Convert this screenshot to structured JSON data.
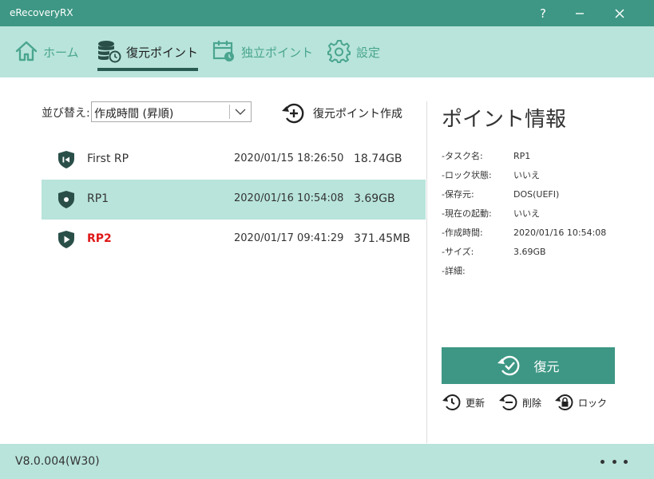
{
  "window": {
    "title": "eRecoveryRX",
    "help_label": "?"
  },
  "nav": {
    "tabs": [
      {
        "label": "ホーム",
        "icon": "home-icon",
        "active": false
      },
      {
        "label": "復元ポイント",
        "icon": "database-restore-icon",
        "active": true
      },
      {
        "label": "独立ポイント",
        "icon": "calendar-icon",
        "active": false
      },
      {
        "label": "設定",
        "icon": "gear-icon",
        "active": false
      }
    ]
  },
  "toolbar": {
    "sort_label": "並び替え:",
    "sort_value": "作成時間 (昇順)",
    "create_label": "復元ポイント作成"
  },
  "restore_points": [
    {
      "name": "First RP",
      "date": "2020/01/15 18:26:50",
      "size": "18.74GB",
      "icon": "shield-first-icon",
      "selected": false,
      "alert": false
    },
    {
      "name": "RP1",
      "date": "2020/01/16 10:54:08",
      "size": "3.69GB",
      "icon": "shield-dot-icon",
      "selected": true,
      "alert": false
    },
    {
      "name": "RP2",
      "date": "2020/01/17 09:41:29",
      "size": "371.45MB",
      "icon": "shield-play-icon",
      "selected": false,
      "alert": true
    }
  ],
  "info": {
    "title": "ポイント情報",
    "rows": [
      {
        "key": "-タスク名:",
        "value": "RP1"
      },
      {
        "key": "-ロック状態:",
        "value": "いいえ"
      },
      {
        "key": "-保存元:",
        "value": "DOS(UEFI)"
      },
      {
        "key": "-現在の起動:",
        "value": "いいえ"
      },
      {
        "key": "-作成時間:",
        "value": "2020/01/16 10:54:08"
      },
      {
        "key": "-サイズ:",
        "value": "3.69GB"
      },
      {
        "key": "-詳細:",
        "value": ""
      }
    ]
  },
  "actions": {
    "restore_label": "復元",
    "update_label": "更新",
    "delete_label": "削除",
    "lock_label": "ロック"
  },
  "footer": {
    "version": "V8.0.004(W30)"
  },
  "colors": {
    "accent": "#3d9784",
    "accent_light": "#b8e4db",
    "dark_icon": "#2a4f49",
    "alert": "#e01818"
  }
}
